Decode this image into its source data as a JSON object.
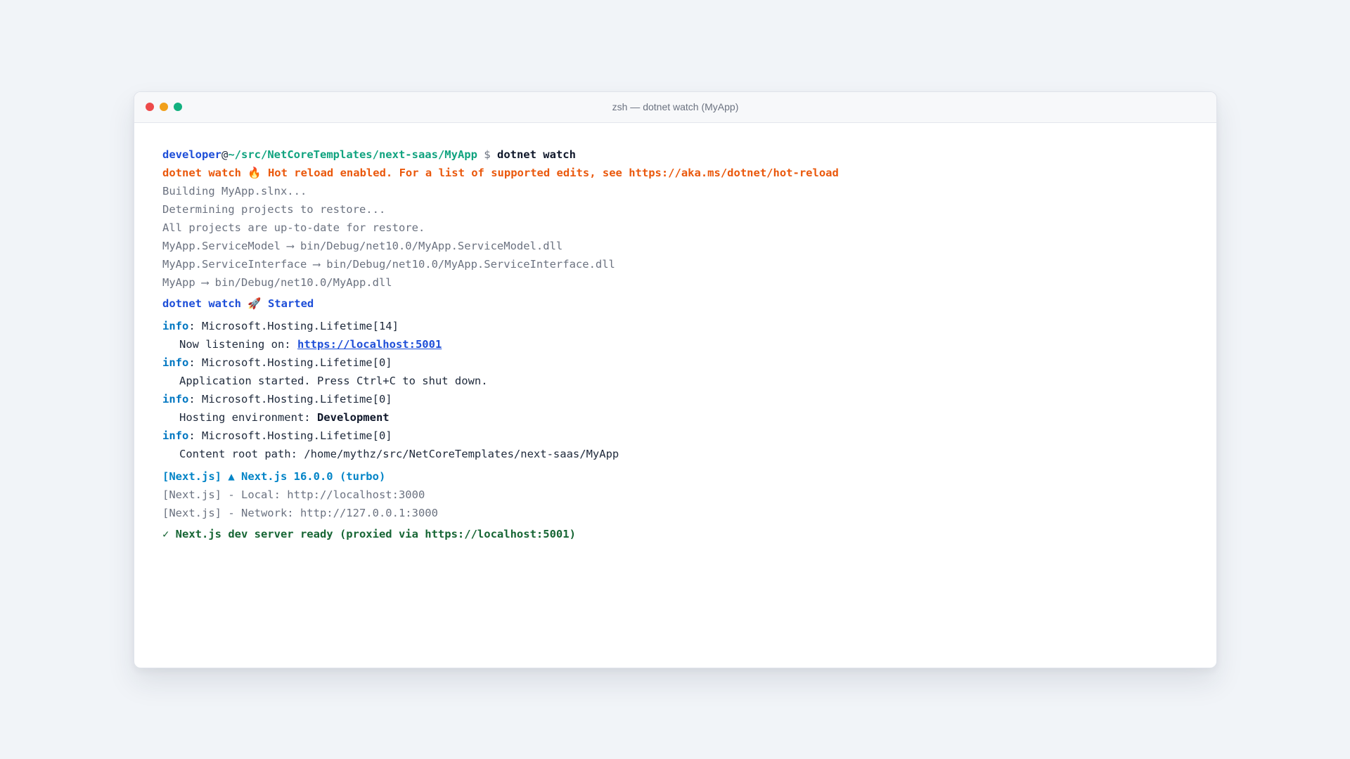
{
  "window": {
    "title": "zsh — dotnet watch (MyApp)",
    "buttons": {
      "close_color": "#ed4a4a",
      "minimize_color": "#f1a01a",
      "maximize_color": "#12b07f"
    }
  },
  "colors": {
    "user": "#1d4ed8",
    "path": "#10a37f",
    "warning": "#ea580c",
    "info": "#0077c2",
    "nextjs": "#0284c7",
    "success": "#166534"
  },
  "prompt": {
    "user": "developer",
    "at": "@",
    "path": "~/src/NetCoreTemplates/next-saas/MyApp",
    "symbol": "$",
    "command": "dotnet watch"
  },
  "hot_reload_line": "dotnet watch 🔥 Hot reload enabled. For a list of supported edits, see https://aka.ms/dotnet/hot-reload",
  "build_output": [
    "Building MyApp.slnx...",
    "Determining projects to restore...",
    "All projects are up-to-date for restore.",
    "MyApp.ServiceModel ⟶ bin/Debug/net10.0/MyApp.ServiceModel.dll",
    "MyApp.ServiceInterface ⟶ bin/Debug/net10.0/MyApp.ServiceInterface.dll",
    "MyApp ⟶ bin/Debug/net10.0/MyApp.dll"
  ],
  "started_line": "dotnet watch 🚀 Started",
  "logs": {
    "level": "info",
    "entry1": {
      "source": ": Microsoft.Hosting.Lifetime[14]",
      "message_prefix": "Now listening on: ",
      "url": "https://localhost:5001"
    },
    "entry2": {
      "source": ": Microsoft.Hosting.Lifetime[0]",
      "message": "Application started. Press Ctrl+C to shut down."
    },
    "entry3": {
      "source": ": Microsoft.Hosting.Lifetime[0]",
      "message_prefix": "Hosting environment: ",
      "environment": "Development"
    },
    "entry4": {
      "source": ": Microsoft.Hosting.Lifetime[0]",
      "message": "Content root path: /home/mythz/src/NetCoreTemplates/next-saas/MyApp"
    }
  },
  "nextjs": {
    "header": "[Next.js] ▲ Next.js 16.0.0 (turbo)",
    "local": "[Next.js] - Local: http://localhost:3000",
    "network": "[Next.js] - Network: http://127.0.0.1:3000"
  },
  "ready_line": "✓ Next.js dev server ready (proxied via https://localhost:5001)"
}
